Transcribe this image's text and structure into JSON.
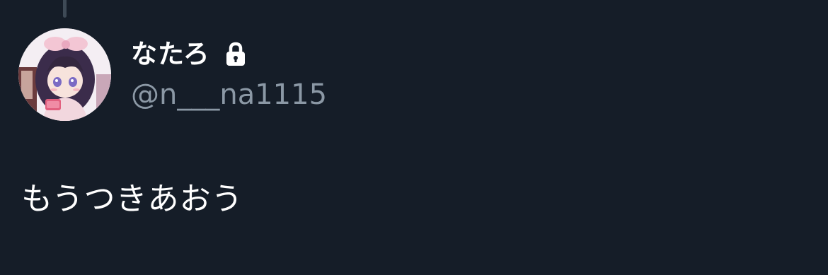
{
  "tweet": {
    "author": {
      "display_name": "なたろ",
      "handle": "@n___na1115",
      "protected_icon": "lock-icon",
      "avatar": "anime-girl-avatar"
    },
    "text": "もうつきあおう"
  },
  "colors": {
    "background": "#151d28",
    "primary_text": "#ffffff",
    "secondary_text": "#8b98a5",
    "thread_line": "#3e4a56"
  }
}
